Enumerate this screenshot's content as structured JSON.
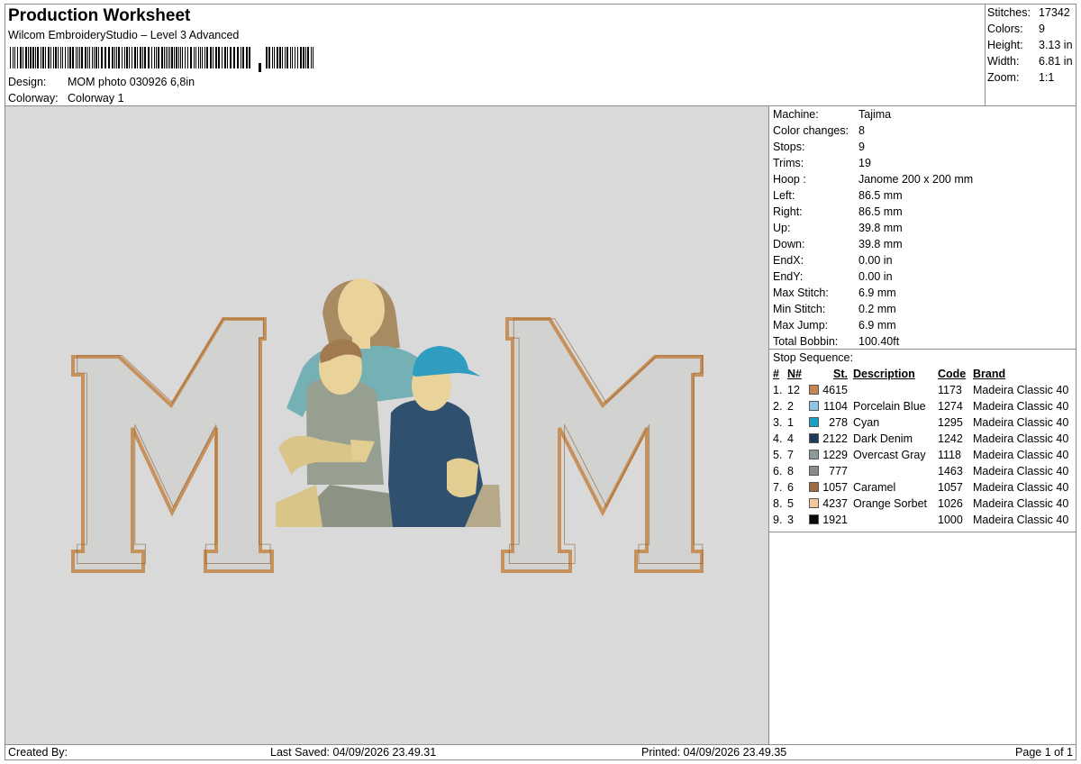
{
  "header": {
    "title": "Production Worksheet",
    "subtitle": "Wilcom EmbroideryStudio – Level 3 Advanced",
    "design_label": "Design:",
    "design_value": "MOM photo 030926 6,8in",
    "colorway_label": "Colorway:",
    "colorway_value": "Colorway 1"
  },
  "summary": [
    {
      "label": "Stitches:",
      "value": "17342"
    },
    {
      "label": "Colors:",
      "value": "9"
    },
    {
      "label": "Height:",
      "value": "3.13 in"
    },
    {
      "label": "Width:",
      "value": "6.81 in"
    },
    {
      "label": "Zoom:",
      "value": "1:1"
    }
  ],
  "machine": [
    {
      "label": "Machine:",
      "value": "Tajima"
    },
    {
      "label": "Color changes:",
      "value": "8"
    },
    {
      "label": "Stops:",
      "value": "9"
    },
    {
      "label": "Trims:",
      "value": "19"
    },
    {
      "label": "Hoop :",
      "value": "Janome 200 x 200 mm"
    },
    {
      "label": "Left:",
      "value": "86.5 mm"
    },
    {
      "label": "Right:",
      "value": "86.5 mm"
    },
    {
      "label": "Up:",
      "value": "39.8 mm"
    },
    {
      "label": "Down:",
      "value": "39.8 mm"
    },
    {
      "label": "EndX:",
      "value": "0.00 in"
    },
    {
      "label": "EndY:",
      "value": "0.00 in"
    },
    {
      "label": "Max Stitch:",
      "value": "6.9 mm"
    },
    {
      "label": "Min Stitch:",
      "value": "0.2 mm"
    },
    {
      "label": "Max Jump:",
      "value": "6.9 mm"
    },
    {
      "label": "Total Bobbin:",
      "value": "100.40ft"
    }
  ],
  "stop_sequence": {
    "title": "Stop Sequence:",
    "headers": {
      "idx": "#",
      "n": "N#",
      "st": "St.",
      "description": "Description",
      "code": "Code",
      "brand": "Brand"
    },
    "rows": [
      {
        "idx": "1.",
        "n": "12",
        "color": "#c8844c",
        "st": "4615",
        "description": "",
        "code": "1173",
        "brand": "Madeira Classic 40"
      },
      {
        "idx": "2.",
        "n": "2",
        "color": "#8fc3e6",
        "st": "1104",
        "description": "Porcelain Blue",
        "code": "1274",
        "brand": "Madeira Classic 40"
      },
      {
        "idx": "3.",
        "n": "1",
        "color": "#1aa0c4",
        "st": "278",
        "description": "Cyan",
        "code": "1295",
        "brand": "Madeira Classic 40"
      },
      {
        "idx": "4.",
        "n": "4",
        "color": "#1e3b5c",
        "st": "2122",
        "description": "Dark Denim",
        "code": "1242",
        "brand": "Madeira Classic 40"
      },
      {
        "idx": "5.",
        "n": "7",
        "color": "#8e999c",
        "st": "1229",
        "description": "Overcast Gray",
        "code": "1118",
        "brand": "Madeira Classic 40"
      },
      {
        "idx": "6.",
        "n": "8",
        "color": "#8a8a88",
        "st": "777",
        "description": "",
        "code": "1463",
        "brand": "Madeira Classic 40"
      },
      {
        "idx": "7.",
        "n": "6",
        "color": "#a06a42",
        "st": "1057",
        "description": "Caramel",
        "code": "1057",
        "brand": "Madeira Classic 40"
      },
      {
        "idx": "8.",
        "n": "5",
        "color": "#f6c79a",
        "st": "4237",
        "description": "Orange Sorbet",
        "code": "1026",
        "brand": "Madeira Classic 40"
      },
      {
        "idx": "9.",
        "n": "3",
        "color": "#0a0a0a",
        "st": "1921",
        "description": "",
        "code": "1000",
        "brand": "Madeira Classic 40"
      }
    ]
  },
  "footer": {
    "created_by": "Created By:",
    "last_saved": "Last Saved: 04/09/2026 23.49.31",
    "printed": "Printed: 04/09/2026 23.49.35",
    "page": "Page 1 of 1"
  }
}
